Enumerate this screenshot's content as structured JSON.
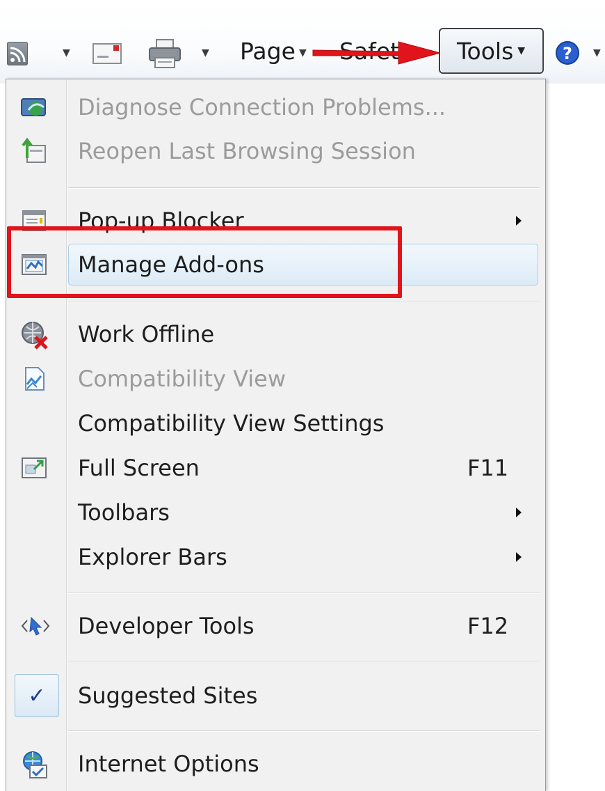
{
  "toolbar": {
    "page_label": "Page",
    "safety_label": "Safet",
    "tools_label": "Tools",
    "icons": [
      "rss-feed-icon",
      "read-mail-icon",
      "print-icon",
      "help-icon"
    ]
  },
  "menu": {
    "items": [
      {
        "label": "Diagnose Connection Problems...",
        "disabled": true,
        "icon": "diagnose-connection-icon"
      },
      {
        "label": "Reopen Last Browsing Session",
        "disabled": true,
        "icon": "reopen-session-icon"
      },
      {
        "label": "Pop-up Blocker",
        "has_submenu": true,
        "icon": "popup-blocker-icon"
      },
      {
        "label": "Manage Add-ons",
        "highlighted": true,
        "icon": "manage-addons-icon"
      },
      {
        "label": "Work Offline",
        "icon": "work-offline-icon"
      },
      {
        "label": "Compatibility View",
        "disabled": true,
        "icon": "compatibility-view-icon"
      },
      {
        "label": "Compatibility View Settings"
      },
      {
        "label": "Full Screen",
        "shortcut": "F11",
        "icon": "full-screen-icon"
      },
      {
        "label": "Toolbars",
        "has_submenu": true
      },
      {
        "label": "Explorer Bars",
        "has_submenu": true
      },
      {
        "label": "Developer Tools",
        "shortcut": "F12",
        "icon": "developer-tools-icon"
      },
      {
        "label": "Suggested Sites",
        "checked": true,
        "check_glyph": "✓"
      },
      {
        "label": "Internet Options",
        "icon": "internet-options-icon"
      }
    ]
  },
  "colors": {
    "annotation_red": "#e0141a",
    "disabled_text": "#9b9b9b",
    "highlight_border": "#a9cbe6"
  }
}
